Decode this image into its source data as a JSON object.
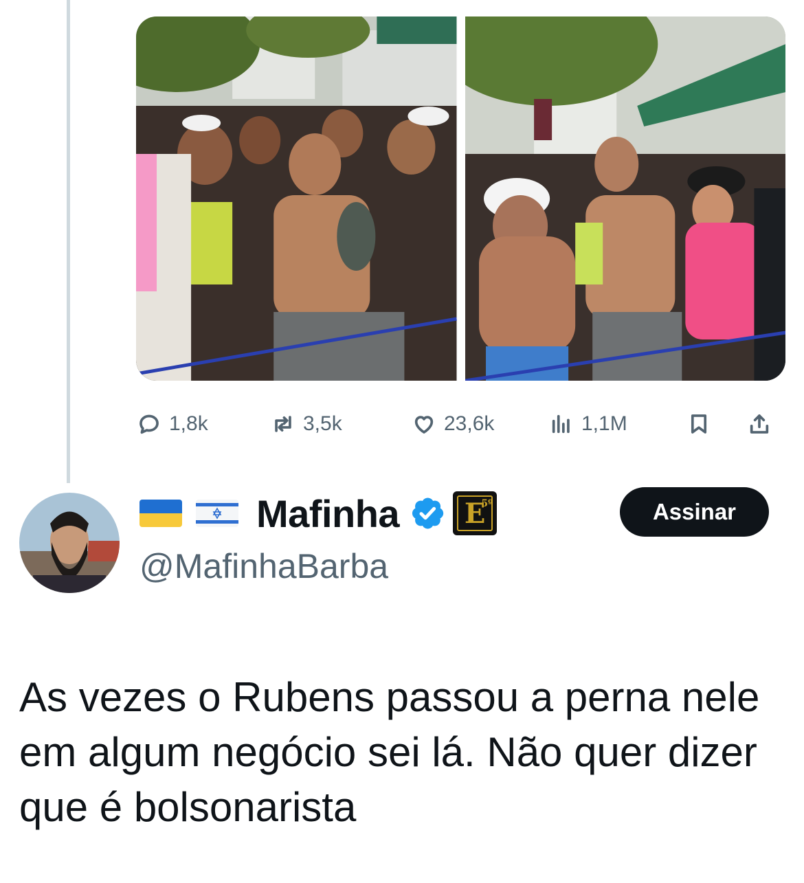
{
  "quoted_tweet": {
    "media": [
      {
        "alt_icon": "photo-crowd-man-dancing"
      },
      {
        "alt_icon": "photo-crowd-man-gesturing"
      }
    ],
    "stats": {
      "replies": "1,8k",
      "reposts": "3,5k",
      "likes": "23,6k",
      "views": "1,1M"
    },
    "icons": {
      "reply": "reply-icon",
      "repost": "repost-icon",
      "like": "like-icon",
      "views": "views-icon",
      "bookmark": "bookmark-icon",
      "share": "share-icon"
    }
  },
  "reply_tweet": {
    "author": {
      "flags": [
        "ukraine-flag",
        "israel-flag"
      ],
      "display_name": "Mafinha",
      "verified": true,
      "affiliation_badge": "E",
      "affiliation_badge_sup": "5º",
      "handle": "@MafinhaBarba"
    },
    "subscribe_label": "Assinar",
    "text": "As vezes o Rubens passou a perna nele em algum negócio sei lá. Não quer dizer que é bolsonarista"
  },
  "colors": {
    "text_primary": "#0f1419",
    "text_secondary": "#536471",
    "verified_blue": "#1d9bf0",
    "thread_line": "#cfd9de",
    "button_bg": "#0f1419"
  }
}
